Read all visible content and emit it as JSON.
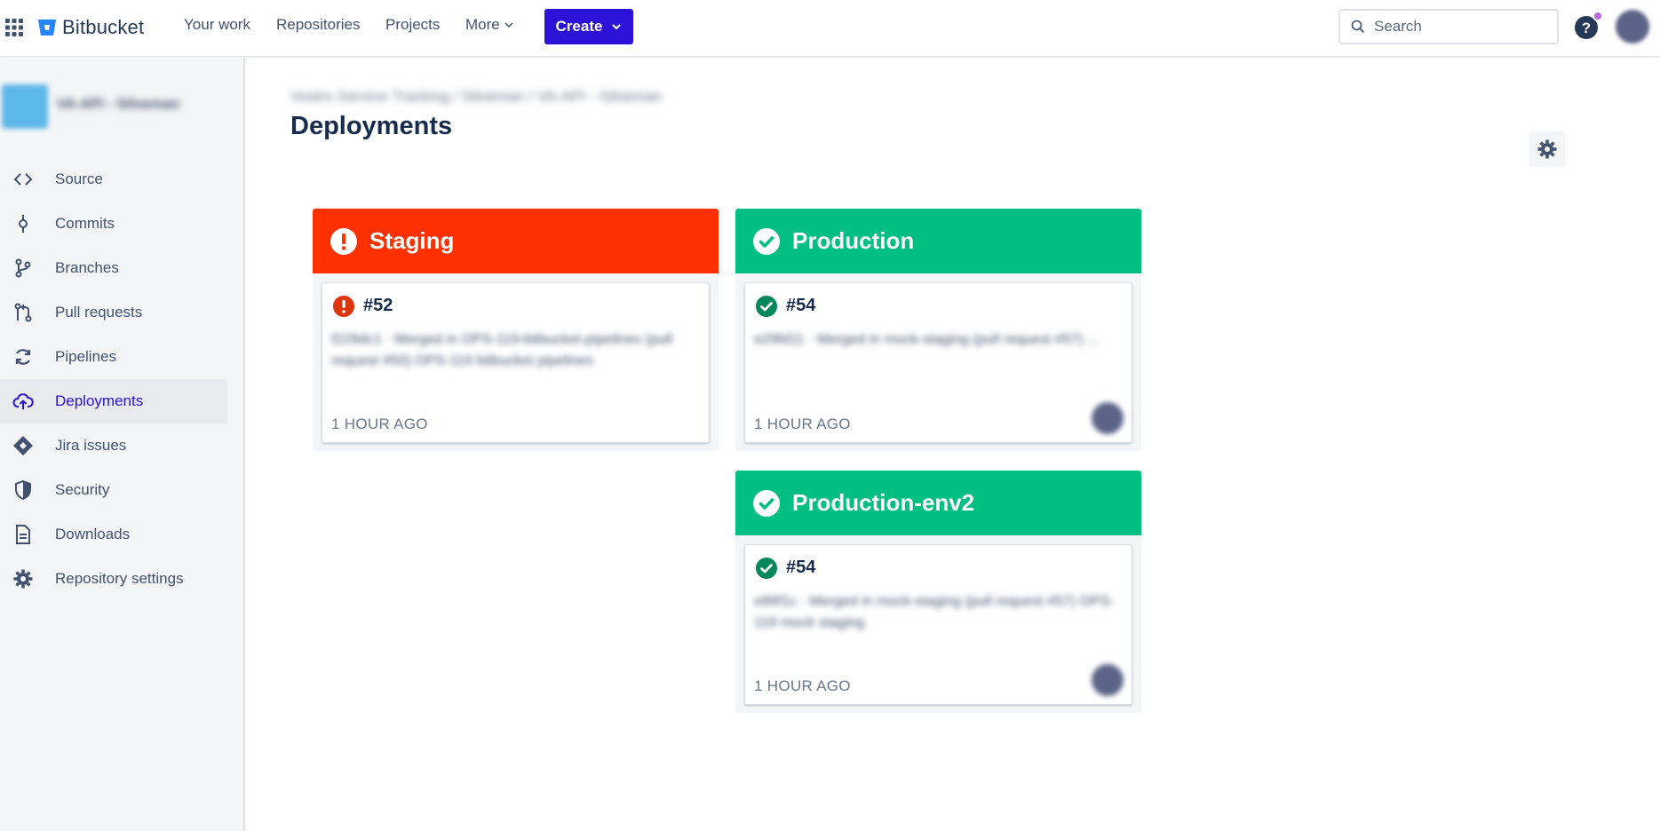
{
  "topnav": {
    "logo": "Bitbucket",
    "items": [
      "Your work",
      "Repositories",
      "Projects",
      "More"
    ],
    "create_label": "Create",
    "search_placeholder": "Search"
  },
  "sidebar": {
    "repo_name": "VA-API - Siloeman",
    "items": [
      {
        "label": "Source",
        "icon": "code-icon"
      },
      {
        "label": "Commits",
        "icon": "commit-icon"
      },
      {
        "label": "Branches",
        "icon": "branch-icon"
      },
      {
        "label": "Pull requests",
        "icon": "pull-request-icon"
      },
      {
        "label": "Pipelines",
        "icon": "pipelines-icon"
      },
      {
        "label": "Deployments",
        "icon": "cloud-upload-icon",
        "active": true
      },
      {
        "label": "Jira issues",
        "icon": "jira-icon"
      },
      {
        "label": "Security",
        "icon": "shield-icon"
      },
      {
        "label": "Downloads",
        "icon": "document-icon"
      },
      {
        "label": "Repository settings",
        "icon": "gear-icon"
      }
    ]
  },
  "main": {
    "breadcrumb": "Vostro Service Tracking / Siloeman / VA-API - Siloeman",
    "title": "Deployments",
    "environments": [
      {
        "name": "Staging",
        "status": "failed",
        "color": "#ff3000",
        "deploy_number": "#52",
        "message": "f229dc1 · Merged in OPS-119-bitbucket-pipelines (pull request #50) OPS-119 bitbucket pipelines",
        "time": "1 HOUR AGO"
      },
      {
        "name": "Production",
        "status": "success",
        "color": "#00bf80",
        "deploy_number": "#54",
        "message": "e29fd11 · Merged in mock-staging (pull request #57) ...",
        "time": "1 HOUR AGO"
      },
      {
        "name": "Production-env2",
        "status": "success",
        "color": "#00bf80",
        "deploy_number": "#54",
        "message": "e89f1c · Merged in mock-staging (pull request #57) OPS-119 mock staging",
        "time": "1 HOUR AGO"
      }
    ]
  },
  "colors": {
    "accent": "#2c11d6",
    "error": "#ff3000",
    "success": "#00bf80",
    "sidebar_bg": "#f4f5f7"
  }
}
